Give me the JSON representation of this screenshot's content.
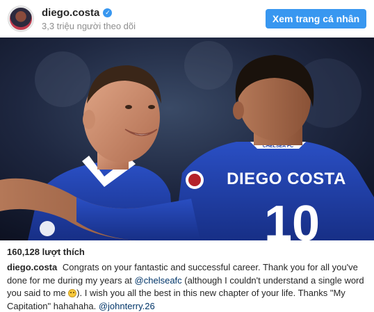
{
  "header": {
    "username": "diego.costa",
    "followers": "3,3 triệu người theo dõi",
    "view_profile_label": "Xem trang cá nhân",
    "verified_icon": "verified-badge-icon"
  },
  "photo": {
    "jersey_name": "DIEGO COSTA",
    "jersey_number": "10",
    "collar_text": "CHELSEA FC",
    "colors": {
      "kit_blue": "#1d3fa8",
      "background": "#151b2e"
    }
  },
  "post": {
    "likes": "160,128 lượt thích",
    "caption_user": "diego.costa",
    "caption_part1": "Congrats on your fantastic and successful career. Thank you for all you've done for me during my years at",
    "mention_club": "@chelseafc",
    "caption_part2": "(although I couldn't understand a single word you said to me",
    "emoji_name": "grinning-face-emoji",
    "caption_part3": "). I wish you all the best in this new chapter of your life. Thanks \"My Capitation\" hahahaha.",
    "mention_player": "@johnterry.26"
  }
}
